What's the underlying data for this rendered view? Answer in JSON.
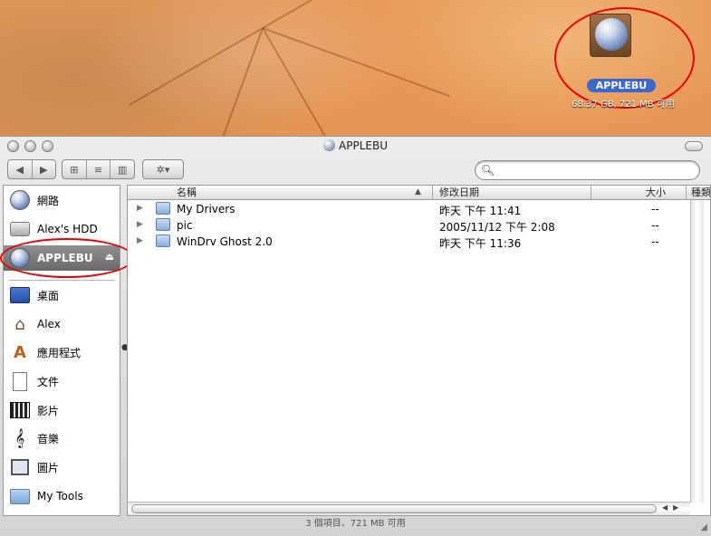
{
  "desktop": {
    "volume_label": "APPLEBU",
    "volume_info": "68.37 GB, 721 MB 可用"
  },
  "window": {
    "title": "APPLEBU",
    "search_placeholder": ""
  },
  "toolbar": {
    "back_icon": "◀",
    "forward_icon": "▶",
    "icon_view": "⊞",
    "list_view": "≡",
    "column_view": "▥",
    "action_icon": "✲▾"
  },
  "sidebar": {
    "items": [
      {
        "label": "網路",
        "icon": "network-globe-icon"
      },
      {
        "label": "Alex's HDD",
        "icon": "hard-drive-icon"
      },
      {
        "label": "APPLEBU",
        "icon": "volume-globe-icon"
      },
      {
        "label": "桌面",
        "icon": "desktop-icon"
      },
      {
        "label": "Alex",
        "icon": "home-icon"
      },
      {
        "label": "應用程式",
        "icon": "applications-icon"
      },
      {
        "label": "文件",
        "icon": "documents-icon"
      },
      {
        "label": "影片",
        "icon": "movies-icon"
      },
      {
        "label": "音樂",
        "icon": "music-icon"
      },
      {
        "label": "圖片",
        "icon": "pictures-icon"
      },
      {
        "label": "My Tools",
        "icon": "folder-icon"
      }
    ]
  },
  "list": {
    "columns": {
      "name": "名稱",
      "date": "修改日期",
      "size": "大小",
      "kind": "種類"
    },
    "rows": [
      {
        "name": "My Drivers",
        "date": "昨天 下午 11:41",
        "size": "--"
      },
      {
        "name": "pic",
        "date": "2005/11/12 下午 2:08",
        "size": "--"
      },
      {
        "name": "WinDrv Ghost 2.0",
        "date": "昨天 下午 11:36",
        "size": "--"
      }
    ]
  },
  "status": {
    "text": "3 個項目、721 MB 可用"
  },
  "colors": {
    "annotation_ring": "#e00000",
    "selection": "#3a67d0"
  }
}
